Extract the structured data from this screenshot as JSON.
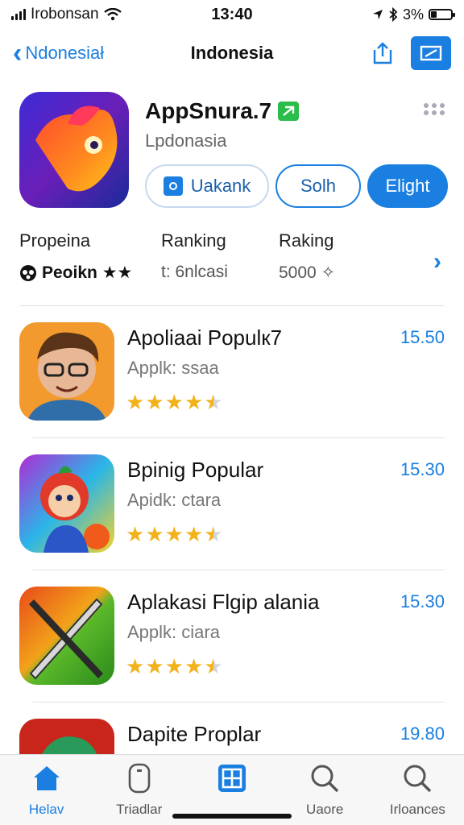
{
  "status_bar": {
    "carrier": "Irobonsan",
    "time": "13:40",
    "battery": "3%",
    "battery_level": 0.3
  },
  "nav": {
    "back_label": "Ndonesiał",
    "title": "Indonesia"
  },
  "app": {
    "name": "AppSnura.7",
    "subtitle": "Lpdonasia",
    "buttons": [
      "Uakank",
      "Solh",
      "Elight"
    ]
  },
  "stats": [
    {
      "label": "Propeina",
      "value": "Peoikn ★★"
    },
    {
      "label": "Ranking",
      "value": "t: 6nlcasi"
    },
    {
      "label": "Raking",
      "value": "5000 ✧"
    }
  ],
  "list": [
    {
      "title": "Apoliaai Populк7",
      "sub": "Applk: ssaa",
      "price": "15.50",
      "rating": 4.5
    },
    {
      "title": "Bpinig Popular",
      "sub": "Apidk: ctara",
      "price": "15.30",
      "rating": 4.5
    },
    {
      "title": "Aplakasi Flgip alania",
      "sub": "Applk: ciara",
      "price": "15.30",
      "rating": 4.5
    },
    {
      "title": "Dapite Proplar",
      "sub": "",
      "price": "19.80",
      "rating": 0
    }
  ],
  "tabs": [
    {
      "label": "Helav",
      "icon": "home-icon",
      "active": true
    },
    {
      "label": "Triadlar",
      "icon": "phone-icon",
      "active": false
    },
    {
      "label": "",
      "icon": "grid-icon",
      "active": false
    },
    {
      "label": "Uaore",
      "icon": "search-icon",
      "active": false
    },
    {
      "label": "Irloances",
      "icon": "search-icon",
      "active": false
    }
  ],
  "colors": {
    "accent": "#1a7fe0",
    "star": "#f2b21c",
    "verify": "#2bbd4a"
  }
}
